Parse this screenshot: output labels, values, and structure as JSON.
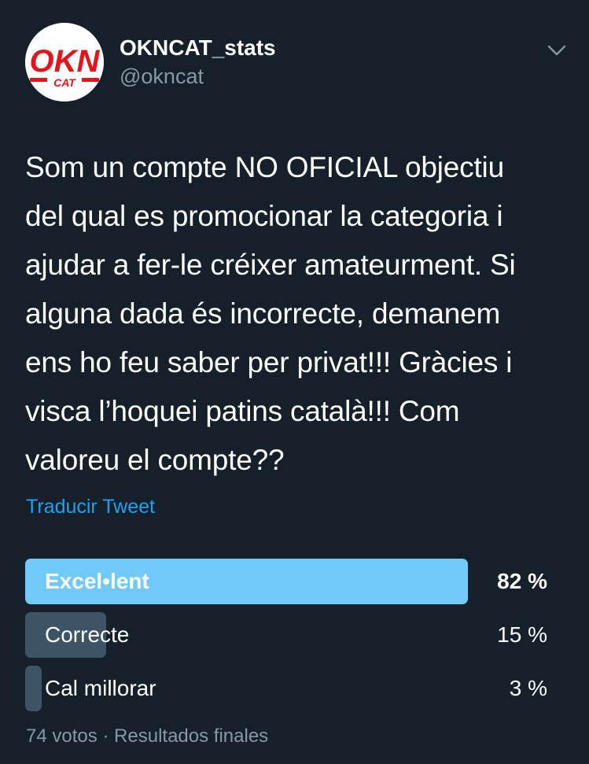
{
  "colors": {
    "background": "#15202b",
    "accent": "#1da1f2",
    "secondary_text": "#8899a6",
    "poll_winner_bar": "#71c9f8",
    "poll_bar": "#3d5466",
    "avatar_red": "#e3151a"
  },
  "user": {
    "name": "OKNCAT_stats",
    "handle": "@okncat",
    "avatar_logo_top": "OKN",
    "avatar_logo_bottom": "CAT"
  },
  "header": {
    "menu_icon": "chevron-down-icon"
  },
  "tweet": {
    "lines": [
      "Som un compte NO OFICIAL objectiu",
      "del qual es promocionar la categoria i",
      "ajudar a fer-le créixer amateurment. Si",
      "alguna dada és incorrecte, demanem",
      "ens ho feu saber per privat!!! Gràcies i",
      "visca l’hoquei patins català!!! Com",
      "valoreu el compte??"
    ],
    "translate_label": "Traducir Tweet"
  },
  "poll": {
    "options": [
      {
        "label": "Excel•lent",
        "percent_text": "82 %",
        "fraction": 0.82,
        "winner": true
      },
      {
        "label": "Correcte",
        "percent_text": "15 %",
        "fraction": 0.15,
        "winner": false
      },
      {
        "label": "Cal millorar",
        "percent_text": "3 %",
        "fraction": 0.03,
        "winner": false
      }
    ],
    "footer": "74 votos · Resultados finales"
  }
}
